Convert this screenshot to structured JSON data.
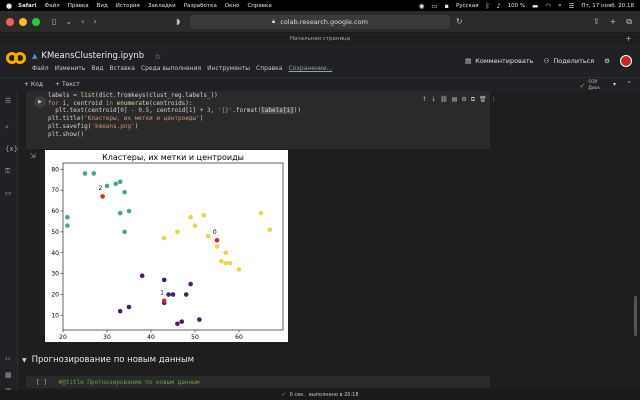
{
  "menubar": {
    "apple": "",
    "items": [
      "Safari",
      "Файл",
      "Правка",
      "Вид",
      "История",
      "Закладки",
      "Разработка",
      "Окно",
      "Справка"
    ],
    "battery": "100 %",
    "language": "Русская",
    "clock": "Пт, 17 нояб. 20:18"
  },
  "safari": {
    "url": "colab.research.google.com",
    "tab_title": "Начальная страница"
  },
  "colab": {
    "notebook_title": "KMeansClustering.ipynb",
    "menu": [
      "Файл",
      "Изменить",
      "Вид",
      "Вставка",
      "Среда выполнения",
      "Инструменты",
      "Справка"
    ],
    "saved_label": "Сохранение...",
    "comment_label": "Комментировать",
    "share_label": "Поделиться",
    "add_code": "+ Код",
    "add_text": "+ Текст",
    "ram_label": "ОЗУ",
    "disk_label": "Диск",
    "section_title": "Прогнозирование по новым данным",
    "next_cell_code": "#@title Прогнозирование по новым данным",
    "status_text": "0 сек.",
    "status_done": "выполнено в 20:18"
  },
  "code_lines": {
    "l1a": "labels = ",
    "l1b": "list",
    "l1c": "(dict.fromkeys(clust_reg.labels_))",
    "l2a": "for",
    "l2b": " i, centroid ",
    "l2c": "in",
    "l2d": " enumerate",
    "l2e": "(centroids):",
    "l3a": "  plt.text(centroid[",
    "l3b": "0",
    "l3c": "] - ",
    "l3d": "0.5",
    "l3e": ", centroid[",
    "l3f": "1",
    "l3g": "] + ",
    "l3h": "3",
    "l3i": ", ",
    "l3j": "'{}'",
    "l3k": ".format(",
    "l3l": "labels[i]",
    "l3m": "))",
    "l4a": "plt.title(",
    "l4b": "'Кластеры, их метки и центроиды'",
    "l4c": ")",
    "l5a": "plt.savefig(",
    "l5b": "'kmeans.png'",
    "l5c": ")",
    "l6": "plt.show()"
  },
  "chart_data": {
    "type": "scatter",
    "title": "Кластеры, их метки и центроиды",
    "xlim": [
      20,
      70
    ],
    "ylim": [
      3,
      83
    ],
    "xticks": [
      20,
      30,
      40,
      50,
      60
    ],
    "yticks": [
      10,
      20,
      30,
      40,
      50,
      60,
      70,
      80
    ],
    "colors": {
      "cluster_0": "#e6d84a",
      "cluster_1": "#4b1f5e",
      "cluster_2": "#4aa58a",
      "centroid": "#d62728"
    },
    "series": [
      {
        "cluster": 2,
        "color": "#4aa58a",
        "x": [
          21,
          21,
          25,
          27,
          30,
          32,
          33,
          34,
          35,
          33,
          34
        ],
        "y": [
          57,
          53,
          78,
          78,
          72,
          73,
          74,
          69,
          60,
          59,
          50
        ]
      },
      {
        "cluster": 0,
        "color": "#e6d84a",
        "x": [
          43,
          46,
          49,
          50,
          52,
          53,
          55,
          57,
          56,
          57,
          58,
          60,
          65,
          67
        ],
        "y": [
          47,
          50,
          57,
          53,
          58,
          48,
          43,
          40,
          36,
          35,
          35,
          32,
          59,
          51
        ]
      },
      {
        "cluster": 1,
        "color": "#4b1f5e",
        "x": [
          38,
          43,
          44,
          45,
          49,
          48,
          47,
          46,
          51,
          35,
          33,
          43
        ],
        "y": [
          29,
          27,
          20,
          20,
          25,
          20,
          7,
          6,
          8,
          14,
          12,
          16
        ]
      }
    ],
    "centroids": [
      {
        "label": "2",
        "x": 29,
        "y": 67
      },
      {
        "label": "0",
        "x": 55,
        "y": 46
      },
      {
        "label": "1",
        "x": 43,
        "y": 17
      }
    ]
  }
}
